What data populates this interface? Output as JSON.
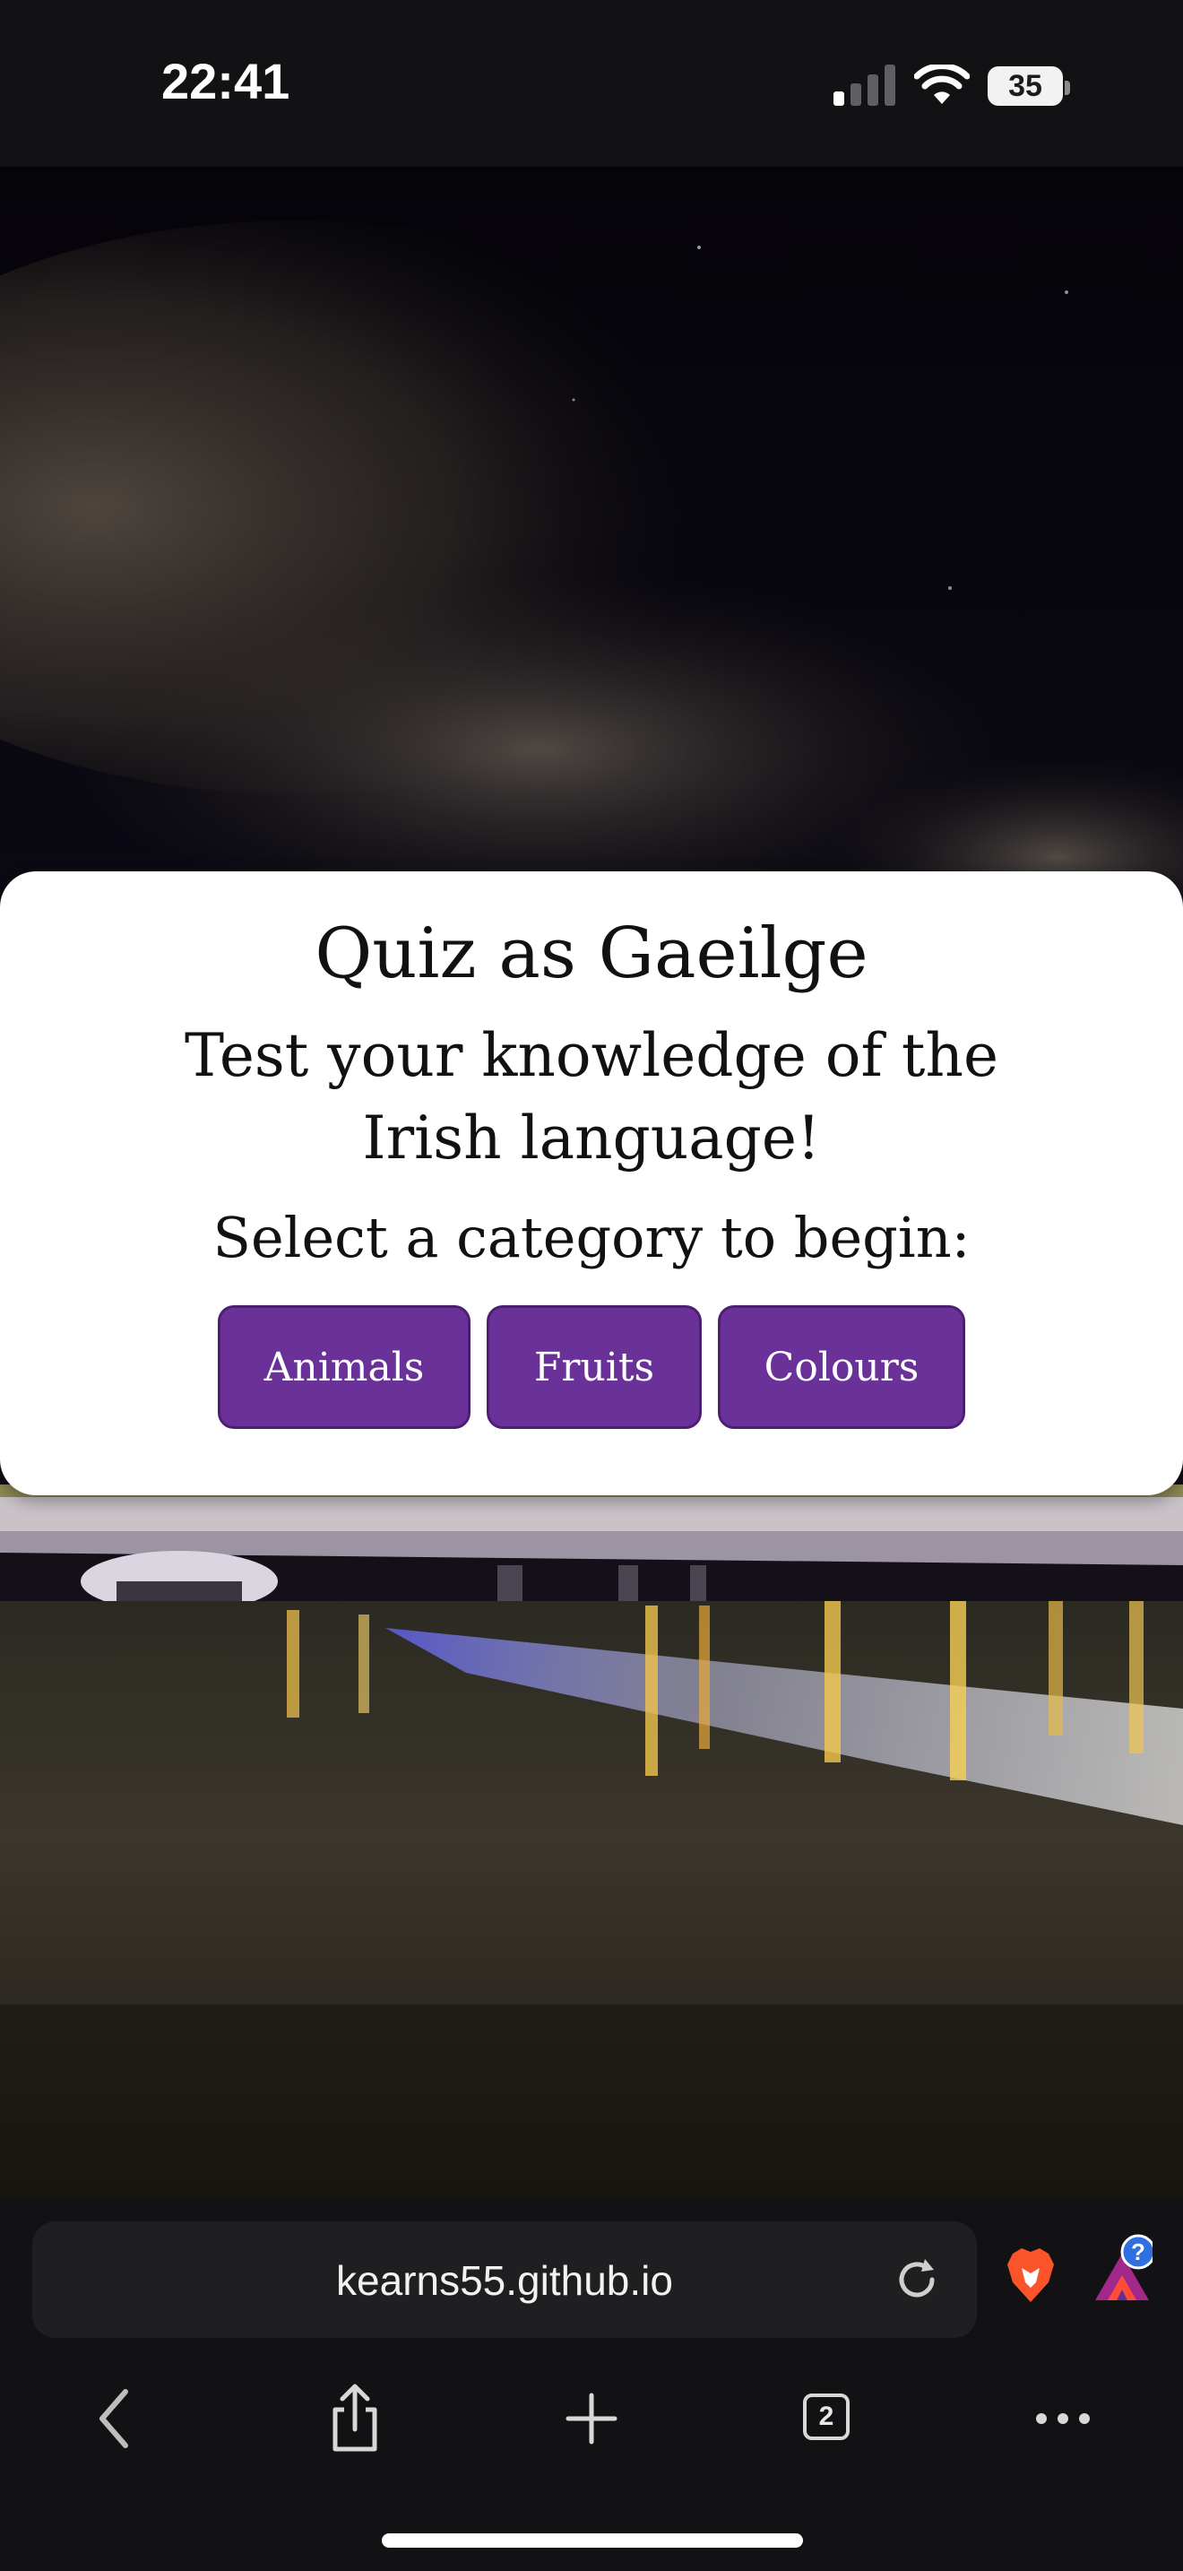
{
  "status_bar": {
    "time": "22:41",
    "battery_level": "35",
    "icons": [
      "cellular-signal-icon",
      "wifi-icon",
      "battery-icon"
    ]
  },
  "quiz": {
    "title": "Quiz as Gaeilge",
    "subtitle": "Test your knowledge of the Irish language!",
    "prompt": "Select a category to begin:",
    "categories": [
      {
        "label": "Animals"
      },
      {
        "label": "Fruits"
      },
      {
        "label": "Colours"
      }
    ],
    "button_color": "#6a3199"
  },
  "browser": {
    "url": "kearns55.github.io",
    "tab_count": "2",
    "rewards_badge": "?",
    "icons": [
      "reload-icon",
      "brave-lion-icon",
      "brave-rewards-icon",
      "back-icon",
      "share-icon",
      "new-tab-icon",
      "tabs-icon",
      "more-icon"
    ]
  }
}
